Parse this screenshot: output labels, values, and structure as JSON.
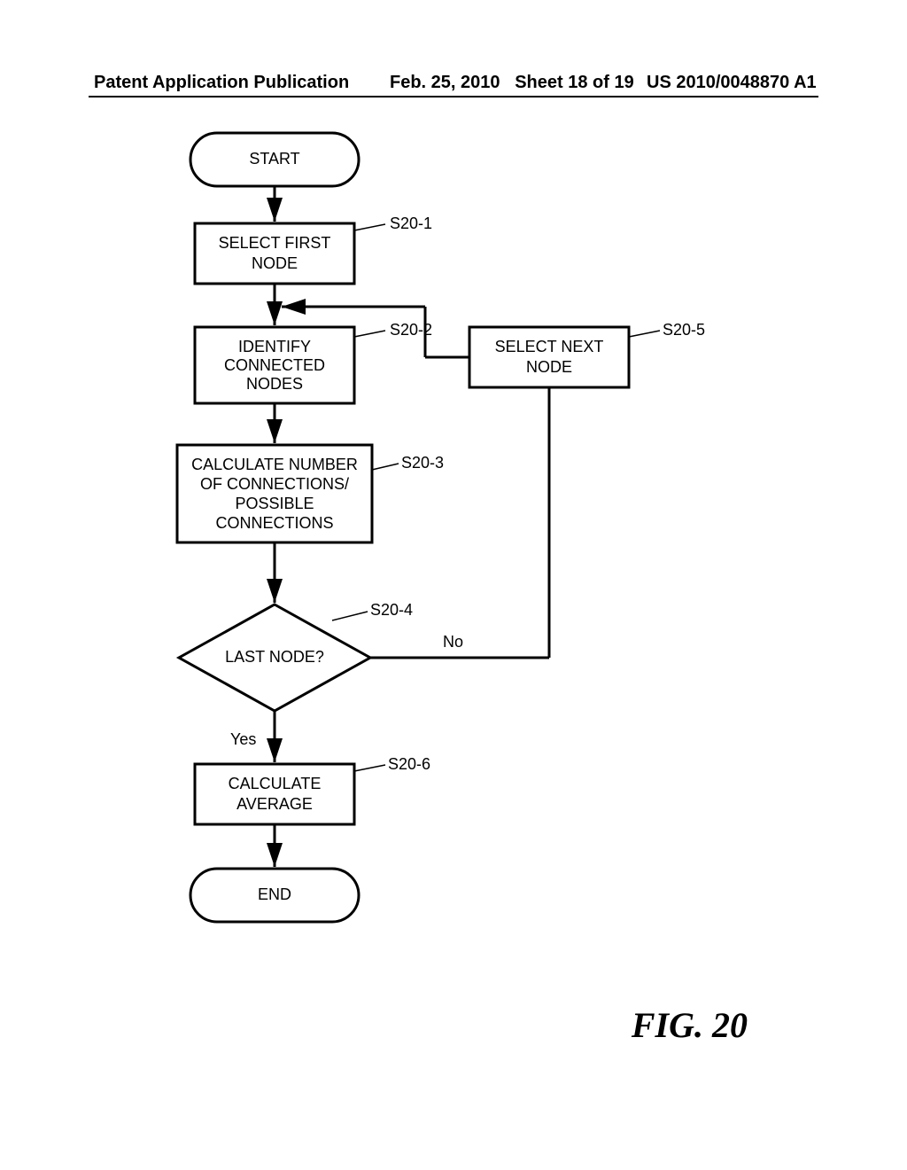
{
  "header": {
    "publication": "Patent Application Publication",
    "date": "Feb. 25, 2010",
    "sheet": "Sheet 18 of 19",
    "docnum": "US 2010/0048870 A1"
  },
  "figure": {
    "caption": "FIG. 20"
  },
  "flowchart": {
    "start": "START",
    "end": "END",
    "step1": {
      "text1": "SELECT FIRST",
      "text2": "NODE",
      "label": "S20-1"
    },
    "step2": {
      "text1": "IDENTIFY",
      "text2": "CONNECTED",
      "text3": "NODES",
      "label": "S20-2"
    },
    "step3": {
      "text1": "CALCULATE NUMBER",
      "text2": "OF CONNECTIONS/",
      "text3": "POSSIBLE",
      "text4": "CONNECTIONS",
      "label": "S20-3"
    },
    "decision": {
      "text": "LAST NODE?",
      "label": "S20-4",
      "yes": "Yes",
      "no": "No"
    },
    "step5": {
      "text1": "SELECT NEXT",
      "text2": "NODE",
      "label": "S20-5"
    },
    "step6": {
      "text1": "CALCULATE",
      "text2": "AVERAGE",
      "label": "S20-6"
    }
  }
}
